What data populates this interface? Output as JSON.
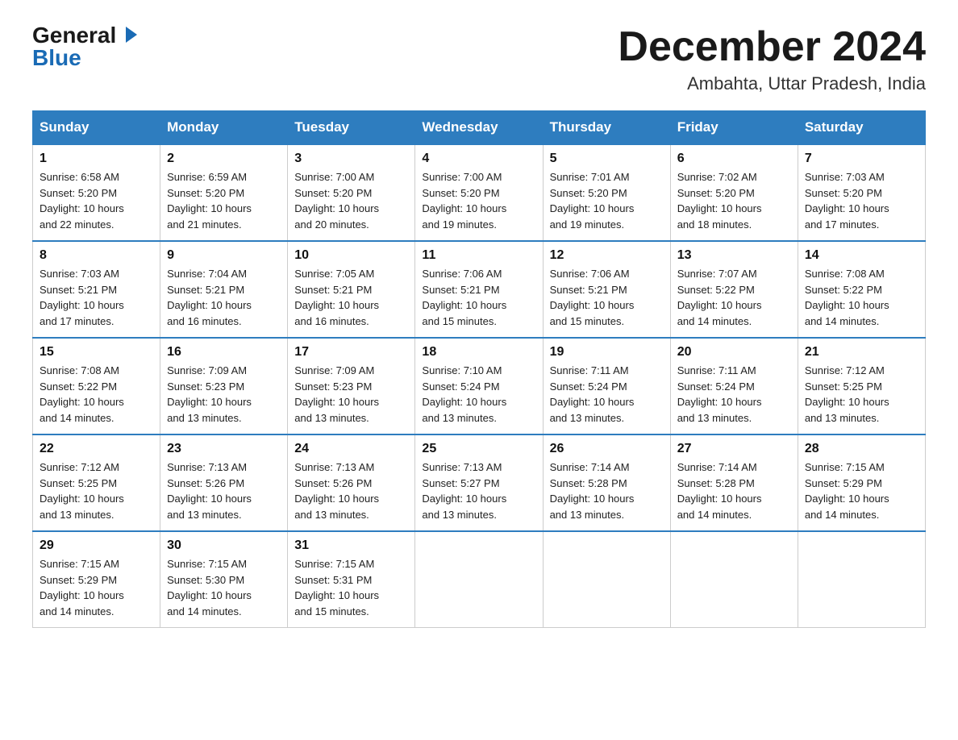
{
  "logo": {
    "general": "General",
    "blue": "Blue"
  },
  "title": "December 2024",
  "location": "Ambahta, Uttar Pradesh, India",
  "days_of_week": [
    "Sunday",
    "Monday",
    "Tuesday",
    "Wednesday",
    "Thursday",
    "Friday",
    "Saturday"
  ],
  "weeks": [
    [
      {
        "day": "1",
        "sunrise": "6:58 AM",
        "sunset": "5:20 PM",
        "daylight": "10 hours and 22 minutes."
      },
      {
        "day": "2",
        "sunrise": "6:59 AM",
        "sunset": "5:20 PM",
        "daylight": "10 hours and 21 minutes."
      },
      {
        "day": "3",
        "sunrise": "7:00 AM",
        "sunset": "5:20 PM",
        "daylight": "10 hours and 20 minutes."
      },
      {
        "day": "4",
        "sunrise": "7:00 AM",
        "sunset": "5:20 PM",
        "daylight": "10 hours and 19 minutes."
      },
      {
        "day": "5",
        "sunrise": "7:01 AM",
        "sunset": "5:20 PM",
        "daylight": "10 hours and 19 minutes."
      },
      {
        "day": "6",
        "sunrise": "7:02 AM",
        "sunset": "5:20 PM",
        "daylight": "10 hours and 18 minutes."
      },
      {
        "day": "7",
        "sunrise": "7:03 AM",
        "sunset": "5:20 PM",
        "daylight": "10 hours and 17 minutes."
      }
    ],
    [
      {
        "day": "8",
        "sunrise": "7:03 AM",
        "sunset": "5:21 PM",
        "daylight": "10 hours and 17 minutes."
      },
      {
        "day": "9",
        "sunrise": "7:04 AM",
        "sunset": "5:21 PM",
        "daylight": "10 hours and 16 minutes."
      },
      {
        "day": "10",
        "sunrise": "7:05 AM",
        "sunset": "5:21 PM",
        "daylight": "10 hours and 16 minutes."
      },
      {
        "day": "11",
        "sunrise": "7:06 AM",
        "sunset": "5:21 PM",
        "daylight": "10 hours and 15 minutes."
      },
      {
        "day": "12",
        "sunrise": "7:06 AM",
        "sunset": "5:21 PM",
        "daylight": "10 hours and 15 minutes."
      },
      {
        "day": "13",
        "sunrise": "7:07 AM",
        "sunset": "5:22 PM",
        "daylight": "10 hours and 14 minutes."
      },
      {
        "day": "14",
        "sunrise": "7:08 AM",
        "sunset": "5:22 PM",
        "daylight": "10 hours and 14 minutes."
      }
    ],
    [
      {
        "day": "15",
        "sunrise": "7:08 AM",
        "sunset": "5:22 PM",
        "daylight": "10 hours and 14 minutes."
      },
      {
        "day": "16",
        "sunrise": "7:09 AM",
        "sunset": "5:23 PM",
        "daylight": "10 hours and 13 minutes."
      },
      {
        "day": "17",
        "sunrise": "7:09 AM",
        "sunset": "5:23 PM",
        "daylight": "10 hours and 13 minutes."
      },
      {
        "day": "18",
        "sunrise": "7:10 AM",
        "sunset": "5:24 PM",
        "daylight": "10 hours and 13 minutes."
      },
      {
        "day": "19",
        "sunrise": "7:11 AM",
        "sunset": "5:24 PM",
        "daylight": "10 hours and 13 minutes."
      },
      {
        "day": "20",
        "sunrise": "7:11 AM",
        "sunset": "5:24 PM",
        "daylight": "10 hours and 13 minutes."
      },
      {
        "day": "21",
        "sunrise": "7:12 AM",
        "sunset": "5:25 PM",
        "daylight": "10 hours and 13 minutes."
      }
    ],
    [
      {
        "day": "22",
        "sunrise": "7:12 AM",
        "sunset": "5:25 PM",
        "daylight": "10 hours and 13 minutes."
      },
      {
        "day": "23",
        "sunrise": "7:13 AM",
        "sunset": "5:26 PM",
        "daylight": "10 hours and 13 minutes."
      },
      {
        "day": "24",
        "sunrise": "7:13 AM",
        "sunset": "5:26 PM",
        "daylight": "10 hours and 13 minutes."
      },
      {
        "day": "25",
        "sunrise": "7:13 AM",
        "sunset": "5:27 PM",
        "daylight": "10 hours and 13 minutes."
      },
      {
        "day": "26",
        "sunrise": "7:14 AM",
        "sunset": "5:28 PM",
        "daylight": "10 hours and 13 minutes."
      },
      {
        "day": "27",
        "sunrise": "7:14 AM",
        "sunset": "5:28 PM",
        "daylight": "10 hours and 14 minutes."
      },
      {
        "day": "28",
        "sunrise": "7:15 AM",
        "sunset": "5:29 PM",
        "daylight": "10 hours and 14 minutes."
      }
    ],
    [
      {
        "day": "29",
        "sunrise": "7:15 AM",
        "sunset": "5:29 PM",
        "daylight": "10 hours and 14 minutes."
      },
      {
        "day": "30",
        "sunrise": "7:15 AM",
        "sunset": "5:30 PM",
        "daylight": "10 hours and 14 minutes."
      },
      {
        "day": "31",
        "sunrise": "7:15 AM",
        "sunset": "5:31 PM",
        "daylight": "10 hours and 15 minutes."
      },
      null,
      null,
      null,
      null
    ]
  ],
  "labels": {
    "sunrise": "Sunrise:",
    "sunset": "Sunset:",
    "daylight": "Daylight:"
  }
}
